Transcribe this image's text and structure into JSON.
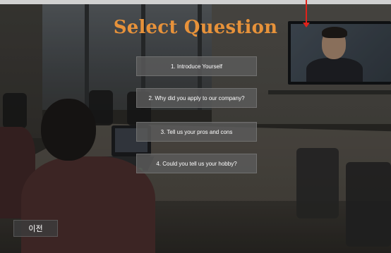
{
  "screen": {
    "title": "Select Question",
    "questions": [
      {
        "label": "1. Introduce Yourself"
      },
      {
        "label": "2. Why did you apply to our company?"
      },
      {
        "label": "3. Tell us your pros and cons"
      },
      {
        "label": "4. Could you tell us your hobby?"
      }
    ],
    "back_button": "이전"
  },
  "colors": {
    "title": "#e7923a",
    "button_bg": "#5c5c5c",
    "marker": "#e0221b"
  },
  "icons": {
    "marker": "red-arrow-marker"
  }
}
